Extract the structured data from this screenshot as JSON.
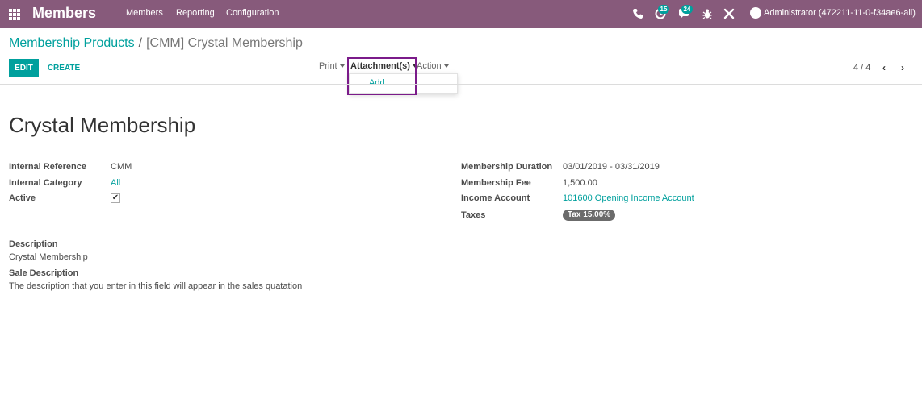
{
  "navbar": {
    "brand": "Members",
    "menus": [
      "Members",
      "Reporting",
      "Configuration"
    ],
    "phone_icon": "phone-icon",
    "activity_count": "15",
    "messages_count": "24",
    "user": "Administrator (472211-11-0-f34ae6-all)"
  },
  "breadcrumb": {
    "parent": "Membership Products",
    "separator": "/",
    "current": "[CMM] Crystal Membership"
  },
  "toolbar": {
    "edit_label": "EDIT",
    "create_label": "CREATE",
    "print_label": "Print",
    "attachments_label": "Attachment(s)",
    "action_label": "Action",
    "attach_add_label": "Add...",
    "pager": "4 / 4"
  },
  "form": {
    "title": "Crystal Membership",
    "internal_reference_label": "Internal Reference",
    "internal_reference": "CMM",
    "internal_category_label": "Internal Category",
    "internal_category": "All",
    "active_label": "Active",
    "active_checked": "✔",
    "membership_duration_label": "Membership Duration",
    "membership_duration": "03/01/2019 - 03/31/2019",
    "membership_fee_label": "Membership Fee",
    "membership_fee": "1,500.00",
    "income_account_label": "Income Account",
    "income_account": "101600 Opening Income Account",
    "taxes_label": "Taxes",
    "tax_tag": "Tax 15.00%",
    "description_label": "Description",
    "description": "Crystal Membership",
    "sale_description_label": "Sale Description",
    "sale_description": "The description that you enter in this field will appear in the sales quatation"
  },
  "colors": {
    "navbar": "#875a7b",
    "accent": "#00a09d",
    "highlight": "#7b1b8a"
  }
}
